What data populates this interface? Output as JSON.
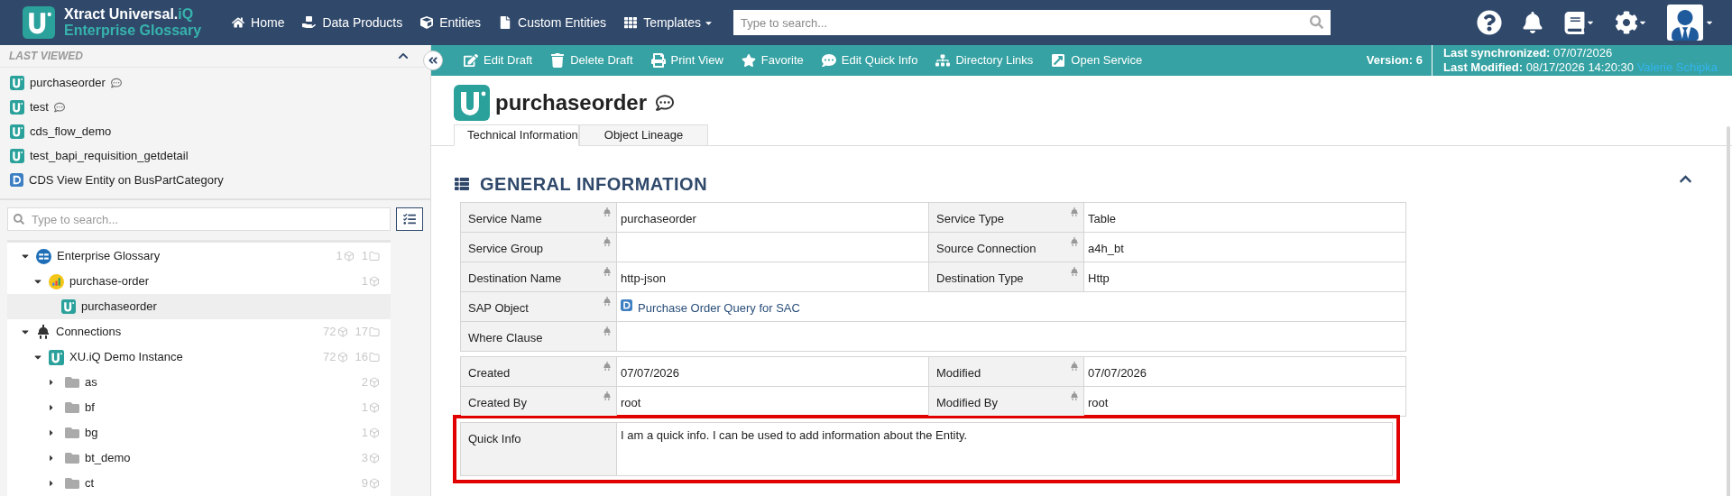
{
  "header": {
    "title_main": "Xtract Universal.",
    "title_accent": "iQ",
    "subtitle": "Enterprise Glossary",
    "nav": [
      {
        "label": "Home",
        "dropdown": false
      },
      {
        "label": "Data Products",
        "dropdown": false
      },
      {
        "label": "Entities",
        "dropdown": false
      },
      {
        "label": "Custom Entities",
        "dropdown": false
      },
      {
        "label": "Templates",
        "dropdown": true
      }
    ],
    "search": {
      "placeholder": "Type to search..."
    }
  },
  "toolbar": {
    "actions": [
      "Edit Draft",
      "Delete Draft",
      "Print View",
      "Favorite",
      "Edit Quick Info",
      "Directory Links",
      "Open Service"
    ],
    "version": "Version: 6",
    "sync_label": "Last synchronized:",
    "sync_value": "07/07/2026",
    "modified_label": "Last Modified:",
    "modified_value": "08/17/2026 14:20:30",
    "modified_by": "Valerie Schipka"
  },
  "sidebar": {
    "title": "LAST VIEWED",
    "expanded": true,
    "recent": [
      {
        "label": "purchaseorder",
        "kind": "entity",
        "quick_info": true
      },
      {
        "label": "test",
        "kind": "entity",
        "quick_info": true
      },
      {
        "label": "cds_flow_demo",
        "kind": "entity",
        "quick_info": false
      },
      {
        "label": "test_bapi_requisition_getdetail",
        "kind": "entity",
        "quick_info": false
      },
      {
        "label": "CDS View Entity on BusPartCategory",
        "kind": "cds",
        "quick_info": false
      }
    ],
    "search": {
      "placeholder": "Type to search..."
    },
    "tree": [
      {
        "label": "Enterprise Glossary",
        "kind": "glossary",
        "expanded": true,
        "selected": false,
        "entities": "1",
        "folders": "1",
        "children": [
          {
            "label": "purchase-order",
            "kind": "category",
            "expanded": true,
            "selected": false,
            "entities": "1",
            "children": [
              {
                "label": "purchaseorder",
                "kind": "entity",
                "selected": true
              }
            ]
          }
        ]
      },
      {
        "label": "Connections",
        "kind": "connections",
        "expanded": true,
        "selected": false,
        "entities": "72",
        "folders": "17",
        "children": [
          {
            "label": "XU.iQ Demo Instance",
            "kind": "instance",
            "expanded": true,
            "selected": false,
            "entities": "72",
            "folders": "16",
            "children": [
              {
                "label": "as",
                "kind": "folder",
                "expanded": false,
                "selected": false,
                "entities": "2"
              },
              {
                "label": "bf",
                "kind": "folder",
                "expanded": false,
                "selected": false,
                "entities": "1"
              },
              {
                "label": "bg",
                "kind": "folder",
                "expanded": false,
                "selected": false,
                "entities": "1"
              },
              {
                "label": "bt_demo",
                "kind": "folder",
                "expanded": false,
                "selected": false,
                "entities": "3"
              },
              {
                "label": "ct",
                "kind": "folder",
                "expanded": false,
                "selected": false,
                "entities": "9"
              }
            ]
          }
        ]
      }
    ]
  },
  "entity": {
    "title": "purchaseorder",
    "quick_info": true,
    "tabs": [
      {
        "label": "Technical Information",
        "selected": true
      },
      {
        "label": "Object Lineage",
        "selected": false
      }
    ],
    "section": {
      "title": "GENERAL INFORMATION",
      "expanded": true,
      "groups": [
        [
          [
            {
              "label": "Service Name",
              "value": "purchaseorder"
            },
            {
              "label": "Service Type",
              "value": "Table"
            }
          ],
          [
            {
              "label": "Service Group"
            },
            {
              "label": "Source Connection",
              "value": "a4h_bt"
            }
          ],
          [
            {
              "label": "Destination Name",
              "value": "http-json"
            },
            {
              "label": "Destination Type",
              "value": "Http"
            }
          ],
          [
            {
              "label": "SAP Object",
              "value": "Purchase Order Query for SAC",
              "kind": "object"
            }
          ],
          [
            {
              "label": "Where Clause"
            }
          ]
        ],
        [
          [
            {
              "label": "Created",
              "value": "07/07/2026"
            },
            {
              "label": "Modified",
              "value": "07/07/2026"
            }
          ],
          [
            {
              "label": "Created By",
              "value": "root"
            },
            {
              "label": "Modified By",
              "value": "root"
            }
          ]
        ]
      ],
      "quick_info": {
        "label": "Quick Info",
        "value": "I am a quick info. I can be used to add information about the Entity.",
        "highlighted": true
      }
    }
  }
}
